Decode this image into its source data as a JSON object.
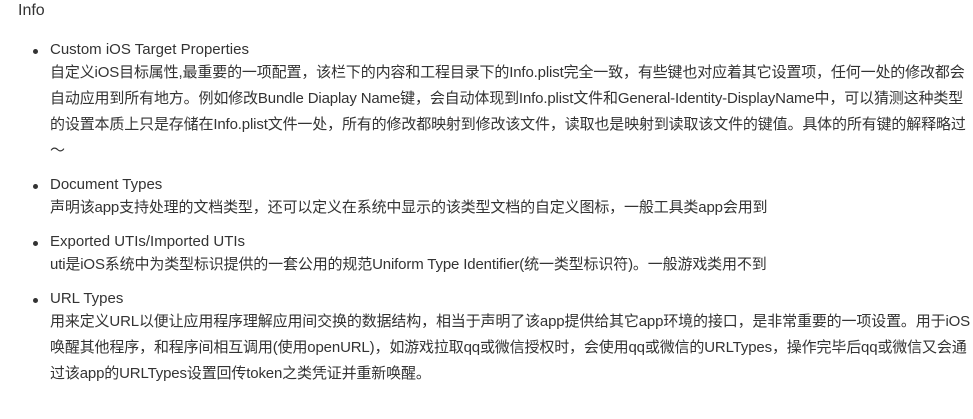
{
  "heading": "Info",
  "items": [
    {
      "title": "Custom iOS Target Properties",
      "desc": "自定义iOS目标属性,最重要的一项配置，该栏下的内容和工程目录下的Info.plist完全一致，有些键也对应着其它设置项，任何一处的修改都会自动应用到所有地方。例如修改Bundle Diaplay Name键，会自动体现到Info.plist文件和General-Identity-DisplayName中，可以猜测这种类型的设置本质上只是存储在Info.plist文件一处，所有的修改都映射到修改该文件，读取也是映射到读取该文件的键值。具体的所有键的解释略过～"
    },
    {
      "title": "Document Types",
      "desc": "声明该app支持处理的文档类型，还可以定义在系统中显示的该类型文档的自定义图标，一般工具类app会用到"
    },
    {
      "title": "Exported UTIs/Imported UTIs",
      "desc": "uti是iOS系统中为类型标识提供的一套公用的规范Uniform Type Identifier(统一类型标识符)。一般游戏类用不到"
    },
    {
      "title": "URL Types",
      "desc": "用来定义URL以便让应用程序理解应用间交换的数据结构，相当于声明了该app提供给其它app环境的接口，是非常重要的一项设置。用于iOS唤醒其他程序，和程序间相互调用(使用openURL)，如游戏拉取qq或微信授权时，会使用qq或微信的URLTypes，操作完毕后qq或微信又会通过该app的URLTypes设置回传token之类凭证并重新唤醒。"
    }
  ]
}
